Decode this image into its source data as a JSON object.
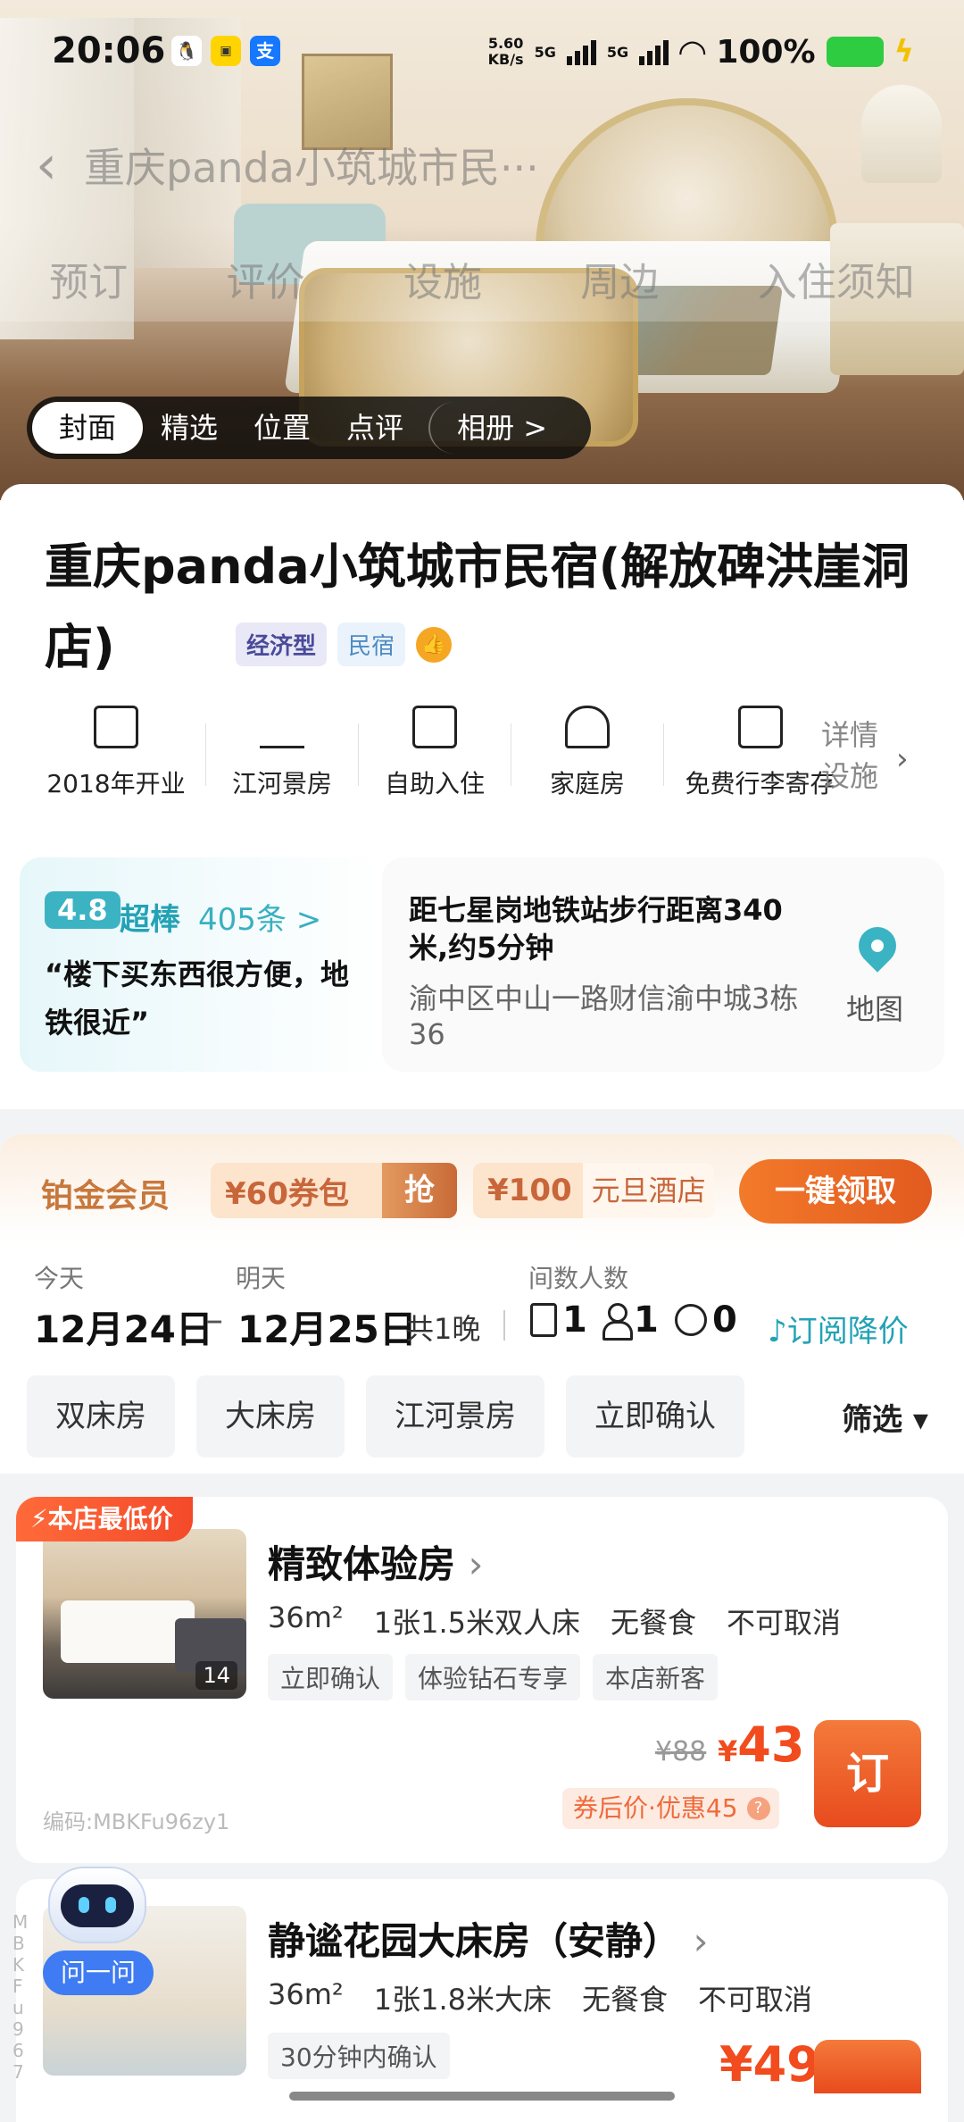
{
  "status_bar": {
    "time": "20:06",
    "net_speed_value": "5.60",
    "net_speed_unit": "KB/s",
    "net1": "5G",
    "net2": "5G",
    "battery": "100%"
  },
  "header": {
    "back_icon": "back-arrow-icon",
    "title": "重庆panda小筑城市民···",
    "tabs": [
      "预订",
      "评价",
      "设施",
      "周边",
      "入住须知"
    ]
  },
  "media_tabs": [
    "封面",
    "精选",
    "位置",
    "点评",
    "相册 >"
  ],
  "hotel": {
    "name": "重庆panda小筑城市民宿(解放碑洪崖洞店)",
    "tag_type": "经济型",
    "tag_category": "民宿",
    "badge_icon": "thumbs-up-icon"
  },
  "facilities": [
    {
      "icon": "building-icon",
      "label": "2018年开业"
    },
    {
      "icon": "river-view-icon",
      "label": "江河景房"
    },
    {
      "icon": "self-checkin-icon",
      "label": "自助入住"
    },
    {
      "icon": "house-icon",
      "label": "家庭房"
    },
    {
      "icon": "luggage-icon",
      "label": "免费行李寄存"
    }
  ],
  "facility_more": {
    "line1": "详情",
    "line2": "设施"
  },
  "rating": {
    "score": "4.8",
    "word": "超棒",
    "count": "405条 >",
    "quote": "“楼下买东西很方便，地铁很近”"
  },
  "location": {
    "distance": "距七星岗地铁站步行距离340米,约5分钟",
    "address": "渝中区中山一路财信渝中城3栋36",
    "map_label": "地图"
  },
  "membership": {
    "title": "铂金会员",
    "coupon1": "¥60券包",
    "coupon1_action": "抢",
    "coupon2_price": "¥100",
    "coupon2_desc": "元旦酒店",
    "claim": "一键领取"
  },
  "dates": {
    "checkin_label": "今天",
    "checkout_label": "明天",
    "guests_label": "间数人数",
    "checkin": "12月24日",
    "dash": "–",
    "checkout": "12月25日",
    "nights": "共1晚",
    "rooms": "1",
    "adults": "1",
    "children": "0",
    "subscribe": "订阅降价"
  },
  "filters": [
    "双床房",
    "大床房",
    "江河景房",
    "立即确认"
  ],
  "filter_button": "筛选 ▾",
  "rooms": [
    {
      "badge": "本店最低价",
      "title": "精致体验房",
      "size": "36m²",
      "bed": "1张1.5米双人床",
      "meal": "无餐食",
      "cancel": "不可取消",
      "tags": [
        "立即确认",
        "体验钻石专享",
        "本店新客"
      ],
      "photo_count": "14",
      "code": "编码:MBKFu96zy1",
      "original_price": "¥88",
      "price_symbol": "¥",
      "price": "43",
      "after_coupon": "券后价·优惠45",
      "book": "订"
    },
    {
      "title": "静谧花园大床房（安静）",
      "size": "36m²",
      "bed": "1张1.8米大床",
      "meal": "无餐食",
      "cancel": "不可取消",
      "tags": [
        "30分钟内确认"
      ],
      "price_partial": "¥49"
    }
  ],
  "assistant": {
    "label": "问一问"
  },
  "vertical_code": "MBKFu967"
}
